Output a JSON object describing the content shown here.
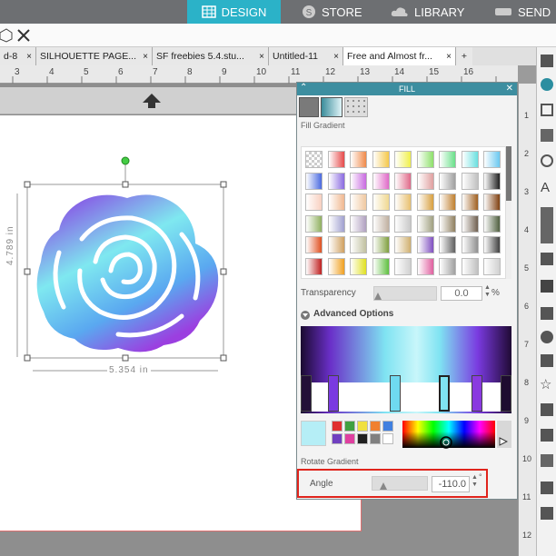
{
  "topnav": {
    "design": "DESIGN",
    "store": "STORE",
    "library": "LIBRARY",
    "send": "SEND"
  },
  "doc_tabs": [
    {
      "label": "d-8"
    },
    {
      "label": "SILHOUETTE PAGE..."
    },
    {
      "label": "SF freebies 5.4.stu..."
    },
    {
      "label": "Untitled-11"
    },
    {
      "label": "Free and Almost fr..."
    }
  ],
  "add_tab": "+",
  "ruler_h_ticks": [
    "3",
    "4",
    "5",
    "6",
    "7",
    "8",
    "9",
    "10",
    "11",
    "12",
    "13",
    "14",
    "15",
    "16"
  ],
  "ruler_v_ticks": [
    "1",
    "2",
    "3",
    "4",
    "5",
    "6",
    "7",
    "8",
    "9",
    "10",
    "11",
    "12"
  ],
  "selection": {
    "height": "4.789 in",
    "width": "5.354 in"
  },
  "fill_panel": {
    "title": "FILL",
    "section": "Fill Gradient",
    "transparency_label": "Transparency",
    "transparency_value": "0.0",
    "transparency_unit": "%",
    "advanced": "Advanced Options",
    "rotate_label": "Rotate Gradient",
    "angle_label": "Angle",
    "angle_value": "-110.0",
    "angle_unit": "°"
  },
  "colors": {
    "accent": "#2bb2c8",
    "panel_title": "#3d8ea0",
    "highlight": "#e0241c"
  }
}
